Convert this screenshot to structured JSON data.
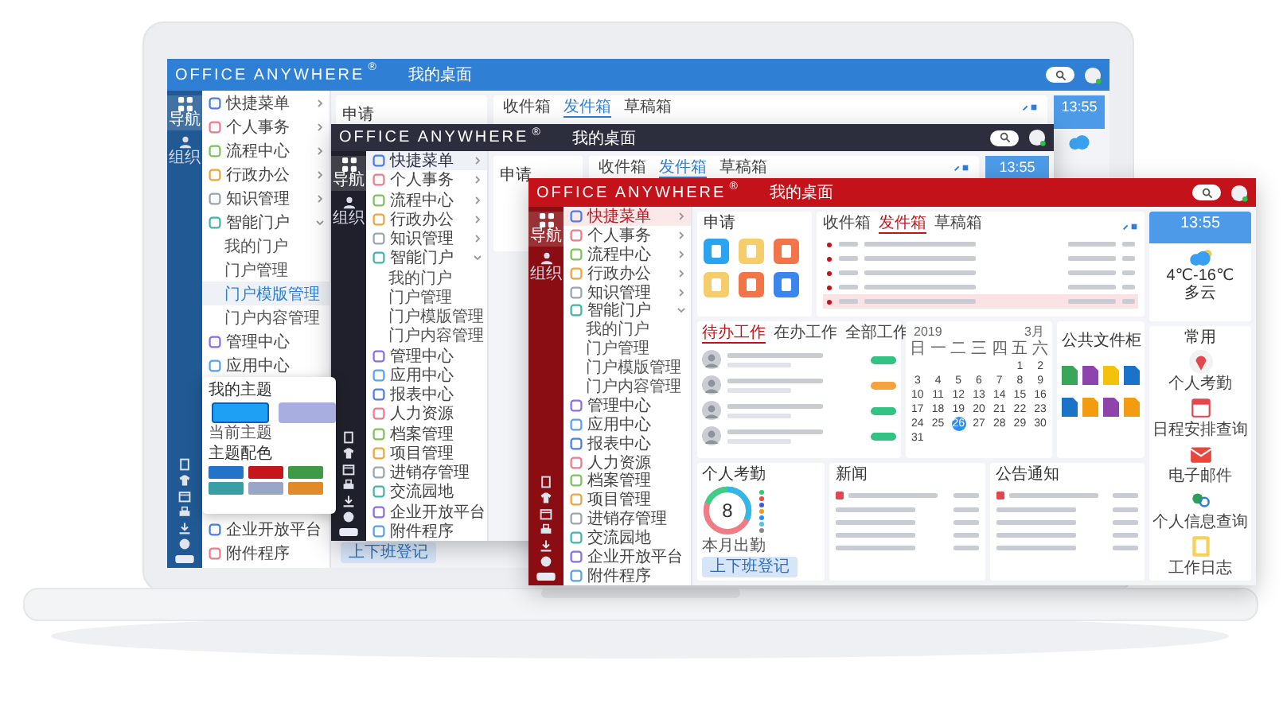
{
  "windows": [
    {
      "kind": "back",
      "color": "#2f7fd4",
      "brand": "OFFICE ANYWHERE",
      "reg": "®",
      "page_title": "我的桌面",
      "rail": [
        {
          "label": "导航",
          "selected": true
        },
        {
          "label": "组织",
          "selected": false
        }
      ],
      "menu": [
        {
          "label": "快捷菜单",
          "selected": false,
          "expanded": false
        },
        {
          "label": "个人事务",
          "selected": false,
          "expanded": false
        },
        {
          "label": "流程中心",
          "selected": false,
          "expanded": false
        },
        {
          "label": "行政办公",
          "selected": false,
          "expanded": false
        },
        {
          "label": "知识管理",
          "selected": false,
          "expanded": false
        },
        {
          "label": "智能门户",
          "selected": false,
          "expanded": true,
          "children": [
            {
              "label": "我的门户",
              "selected": false
            },
            {
              "label": "门户管理",
              "selected": false
            },
            {
              "label": "门户模版管理",
              "selected": true
            },
            {
              "label": "门户内容管理",
              "selected": false
            }
          ]
        },
        {
          "label": "管理中心",
          "selected": false
        },
        {
          "label": "应用中心",
          "selected": false
        }
      ],
      "theme_panel": {
        "title": "我的主题",
        "themes": [
          {
            "label": "当前主题",
            "color": "#1ea0f5",
            "selected": true
          },
          {
            "color": "#a9aee0",
            "selected": false
          }
        ],
        "palette_title": "主题配色",
        "swatches": [
          {
            "color": "#2373c9"
          },
          {
            "color": "#c4161c"
          },
          {
            "color": "#3f9a48"
          },
          {
            "color": "#3a9ea5"
          },
          {
            "color": "#9aa7c4"
          },
          {
            "color": "#e08a2a"
          }
        ]
      },
      "menu_below_panel": [
        {
          "label": "企业开放平台",
          "selected": false
        },
        {
          "label": "附件程序",
          "selected": false
        }
      ],
      "apply": {
        "title": "申请"
      },
      "mail_tabs": [
        {
          "label": "收件箱",
          "selected": false
        },
        {
          "label": "发件箱",
          "selected": true
        },
        {
          "label": "草稿箱",
          "selected": false
        }
      ],
      "clock": "13:55",
      "attendance_button": "上下班登记"
    },
    {
      "kind": "middle",
      "color": "#2c2e3e",
      "brand": "OFFICE ANYWHERE",
      "reg": "®",
      "page_title": "我的桌面",
      "rail": [
        {
          "label": "导航",
          "selected": true
        },
        {
          "label": "组织",
          "selected": false
        }
      ],
      "menu": [
        {
          "label": "快捷菜单",
          "selected": true,
          "expanded": false
        },
        {
          "label": "个人事务",
          "selected": false,
          "expanded": false
        },
        {
          "label": "流程中心",
          "selected": false,
          "expanded": false
        },
        {
          "label": "行政办公",
          "selected": false,
          "expanded": false
        },
        {
          "label": "知识管理",
          "selected": false,
          "expanded": false
        },
        {
          "label": "智能门户",
          "selected": false,
          "expanded": true,
          "children": [
            {
              "label": "我的门户",
              "selected": false
            },
            {
              "label": "门户管理",
              "selected": false
            },
            {
              "label": "门户模版管理",
              "selected": false
            },
            {
              "label": "门户内容管理",
              "selected": false
            }
          ]
        },
        {
          "label": "管理中心",
          "selected": false
        },
        {
          "label": "应用中心",
          "selected": false
        },
        {
          "label": "报表中心",
          "selected": false
        },
        {
          "label": "人力资源",
          "selected": false
        },
        {
          "label": "档案管理",
          "selected": false
        },
        {
          "label": "项目管理",
          "selected": false
        },
        {
          "label": "进销存管理",
          "selected": false
        },
        {
          "label": "交流园地",
          "selected": false
        },
        {
          "label": "企业开放平台",
          "selected": false
        },
        {
          "label": "附件程序",
          "selected": false
        }
      ],
      "apply": {
        "title": "申请"
      },
      "mail_tabs": [
        {
          "label": "收件箱",
          "selected": false
        },
        {
          "label": "发件箱",
          "selected": true
        },
        {
          "label": "草稿箱",
          "selected": false
        }
      ],
      "clock": "13:55"
    },
    {
      "kind": "front",
      "color": "#c3121a",
      "brand": "OFFICE ANYWHERE",
      "reg": "®",
      "page_title": "我的桌面",
      "rail": [
        {
          "label": "导航",
          "selected": true
        },
        {
          "label": "组织",
          "selected": false
        }
      ],
      "menu": [
        {
          "label": "快捷菜单",
          "selected": true,
          "expanded": false
        },
        {
          "label": "个人事务",
          "selected": false,
          "expanded": false
        },
        {
          "label": "流程中心",
          "selected": false,
          "expanded": false
        },
        {
          "label": "行政办公",
          "selected": false,
          "expanded": false
        },
        {
          "label": "知识管理",
          "selected": false,
          "expanded": false
        },
        {
          "label": "智能门户",
          "selected": false,
          "expanded": true,
          "children": [
            {
              "label": "我的门户",
              "selected": false
            },
            {
              "label": "门户管理",
              "selected": false
            },
            {
              "label": "门户模版管理",
              "selected": false
            },
            {
              "label": "门户内容管理",
              "selected": false
            }
          ]
        },
        {
          "label": "管理中心",
          "selected": false
        },
        {
          "label": "应用中心",
          "selected": false
        },
        {
          "label": "报表中心",
          "selected": false
        },
        {
          "label": "人力资源",
          "selected": false
        },
        {
          "label": "档案管理",
          "selected": false
        },
        {
          "label": "项目管理",
          "selected": false
        },
        {
          "label": "进销存管理",
          "selected": false
        },
        {
          "label": "交流园地",
          "selected": false
        },
        {
          "label": "企业开放平台",
          "selected": false
        },
        {
          "label": "附件程序",
          "selected": false
        }
      ],
      "apply": {
        "title": "申请",
        "apps": [
          {
            "color": "#2aa3f0"
          },
          {
            "color": "#f5cd6a"
          },
          {
            "color": "#f27449"
          },
          {
            "color": "#f5cd6a"
          },
          {
            "color": "#f27449"
          },
          {
            "color": "#3b86ee"
          }
        ]
      },
      "mail": {
        "tabs": [
          {
            "label": "收件箱",
            "selected": false
          },
          {
            "label": "发件箱",
            "selected": true
          },
          {
            "label": "草稿箱",
            "selected": false
          }
        ],
        "rows": [
          {
            "selected": false
          },
          {
            "selected": false
          },
          {
            "selected": false
          },
          {
            "selected": false
          },
          {
            "selected": true
          }
        ]
      },
      "clock": {
        "time": "13:55",
        "temperature": "4℃-16℃",
        "weather": "多云"
      },
      "work": {
        "tabs": [
          {
            "label": "待办工作",
            "selected": true
          },
          {
            "label": "在办工作",
            "selected": false
          },
          {
            "label": "全部工作",
            "selected": false
          }
        ],
        "rows": [
          {
            "color": "#34c184"
          },
          {
            "color": "#f5a341"
          },
          {
            "color": "#34c184"
          },
          {
            "color": "#34c184"
          }
        ]
      },
      "calendar": {
        "year": "2019",
        "month": "3月",
        "weekdays": [
          "日",
          "一",
          "二",
          "三",
          "四",
          "五",
          "六"
        ],
        "weeks": [
          [
            {
              "label": "1",
              "selected": false
            },
            {
              "label": "2",
              "selected": false
            }
          ],
          [
            {
              "label": "3",
              "selected": false
            },
            {
              "label": "4",
              "selected": false
            },
            {
              "label": "5",
              "selected": false
            },
            {
              "label": "6",
              "selected": false
            },
            {
              "label": "7",
              "selected": false
            },
            {
              "label": "8",
              "selected": false
            },
            {
              "label": "9",
              "selected": false
            }
          ],
          [
            {
              "label": "10",
              "selected": false
            },
            {
              "label": "11",
              "selected": false
            },
            {
              "label": "12",
              "selected": false
            },
            {
              "label": "13",
              "selected": false
            },
            {
              "label": "14",
              "selected": false
            },
            {
              "label": "15",
              "selected": false
            },
            {
              "label": "16",
              "selected": false
            }
          ],
          [
            {
              "label": "17",
              "selected": false
            },
            {
              "label": "18",
              "selected": false
            },
            {
              "label": "19",
              "selected": false
            },
            {
              "label": "20",
              "selected": false
            },
            {
              "label": "21",
              "selected": false
            },
            {
              "label": "22",
              "selected": false
            },
            {
              "label": "23",
              "selected": false
            }
          ],
          [
            {
              "label": "24",
              "selected": false
            },
            {
              "label": "25",
              "selected": false
            },
            {
              "label": "26",
              "selected": true
            },
            {
              "label": "27",
              "selected": false
            },
            {
              "label": "28",
              "selected": false
            },
            {
              "label": "29",
              "selected": false
            },
            {
              "label": "30",
              "selected": false
            }
          ],
          [
            {
              "label": "31",
              "selected": false
            }
          ]
        ]
      },
      "files": {
        "title": "公共文件柜",
        "items": [
          {
            "color": "#3aa55b"
          },
          {
            "color": "#8e44ad"
          },
          {
            "color": "#f4c20d"
          },
          {
            "color": "#1a73c8"
          },
          {
            "color": "#1a73c8"
          },
          {
            "color": "#f39c12"
          },
          {
            "color": "#8e44ad"
          },
          {
            "color": "#f39c12"
          }
        ]
      },
      "attendance": {
        "title": "个人考勤",
        "value": "8",
        "caption": "本月出勤",
        "legend": [
          {
            "color": "#2ecc71"
          },
          {
            "color": "#e74c3c"
          },
          {
            "color": "#3b5bdb"
          },
          {
            "color": "#f39c12"
          },
          {
            "color": "#1e90ff"
          },
          {
            "color": "#5bc0de"
          },
          {
            "color": "#888888"
          }
        ],
        "button": "上下班登记"
      },
      "news": {
        "title": "新闻",
        "items": [
          {
            "pinned": true
          },
          {
            "pinned": false
          },
          {
            "pinned": false
          },
          {
            "pinned": false
          },
          {
            "pinned": false
          }
        ]
      },
      "notice": {
        "title": "公告通知",
        "items": [
          {
            "pinned": true
          },
          {
            "pinned": false
          },
          {
            "pinned": false
          },
          {
            "pinned": false
          },
          {
            "pinned": false
          }
        ]
      },
      "common": {
        "title": "常用",
        "items": [
          {
            "label": "个人考勤",
            "kind": "pin"
          },
          {
            "label": "日程安排查询",
            "kind": "calendar"
          },
          {
            "label": "电子邮件",
            "kind": "mail"
          },
          {
            "label": "个人信息查询",
            "kind": "search"
          },
          {
            "label": "工作日志",
            "kind": "log"
          }
        ]
      }
    }
  ]
}
